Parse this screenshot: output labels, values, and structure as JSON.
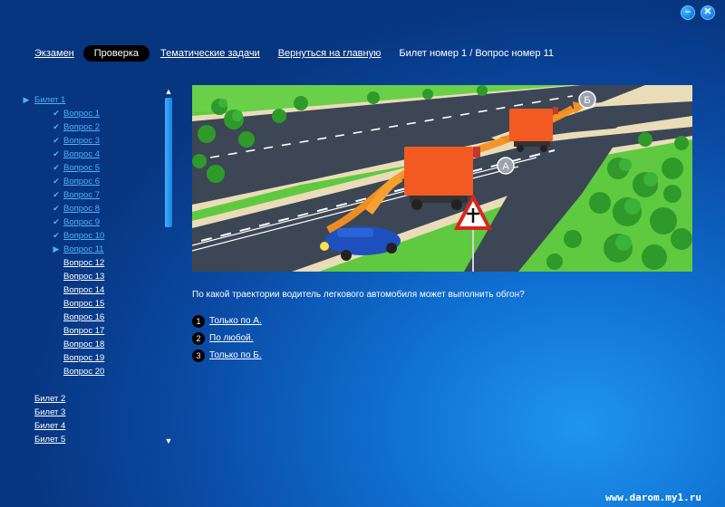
{
  "window": {
    "minimize_label": "–",
    "close_label": "✕"
  },
  "nav": {
    "exam": "Экзамен",
    "check": "Проверка",
    "topics": "Тематические задачи",
    "home": "Вернуться на главную",
    "crumb": "Билет номер 1 / Вопрос номер 11"
  },
  "sidebar": {
    "ticket1": "Билет 1",
    "questions": [
      "Вопрос 1",
      "Вопрос 2",
      "Вопрос 3",
      "Вопрос 4",
      "Вопрос 5",
      "Вопрос 6",
      "Вопрос 7",
      "Вопрос 8",
      "Вопрос 9",
      "Вопрос 10",
      "Вопрос 11",
      "Вопрос 12",
      "Вопрос 13",
      "Вопрос 14",
      "Вопрос 15",
      "Вопрос 16",
      "Вопрос 17",
      "Вопрос 18",
      "Вопрос 19",
      "Вопрос 20"
    ],
    "answered_count": 10,
    "current_index": 10,
    "tickets": [
      "Билет 2",
      "Билет 3",
      "Билет 4",
      "Билет 5"
    ]
  },
  "scroll": {
    "up": "▲",
    "down": "▼"
  },
  "illustration": {
    "label_a": "А",
    "label_b": "Б"
  },
  "question": "По какой траектории водитель легкового автомобиля может выполнить обгон?",
  "answers": [
    {
      "num": "1",
      "text": "Только по А."
    },
    {
      "num": "2",
      "text": "По любой."
    },
    {
      "num": "3",
      "text": "Только по Б."
    }
  ],
  "watermark": "www.darom.my1.ru",
  "colors": {
    "background": "#0a4aa4",
    "accent": "#4fb0ff",
    "road": "#3c4654",
    "grass": "#55c23c",
    "truck": "#f25a22",
    "car": "#1f4fbf"
  }
}
